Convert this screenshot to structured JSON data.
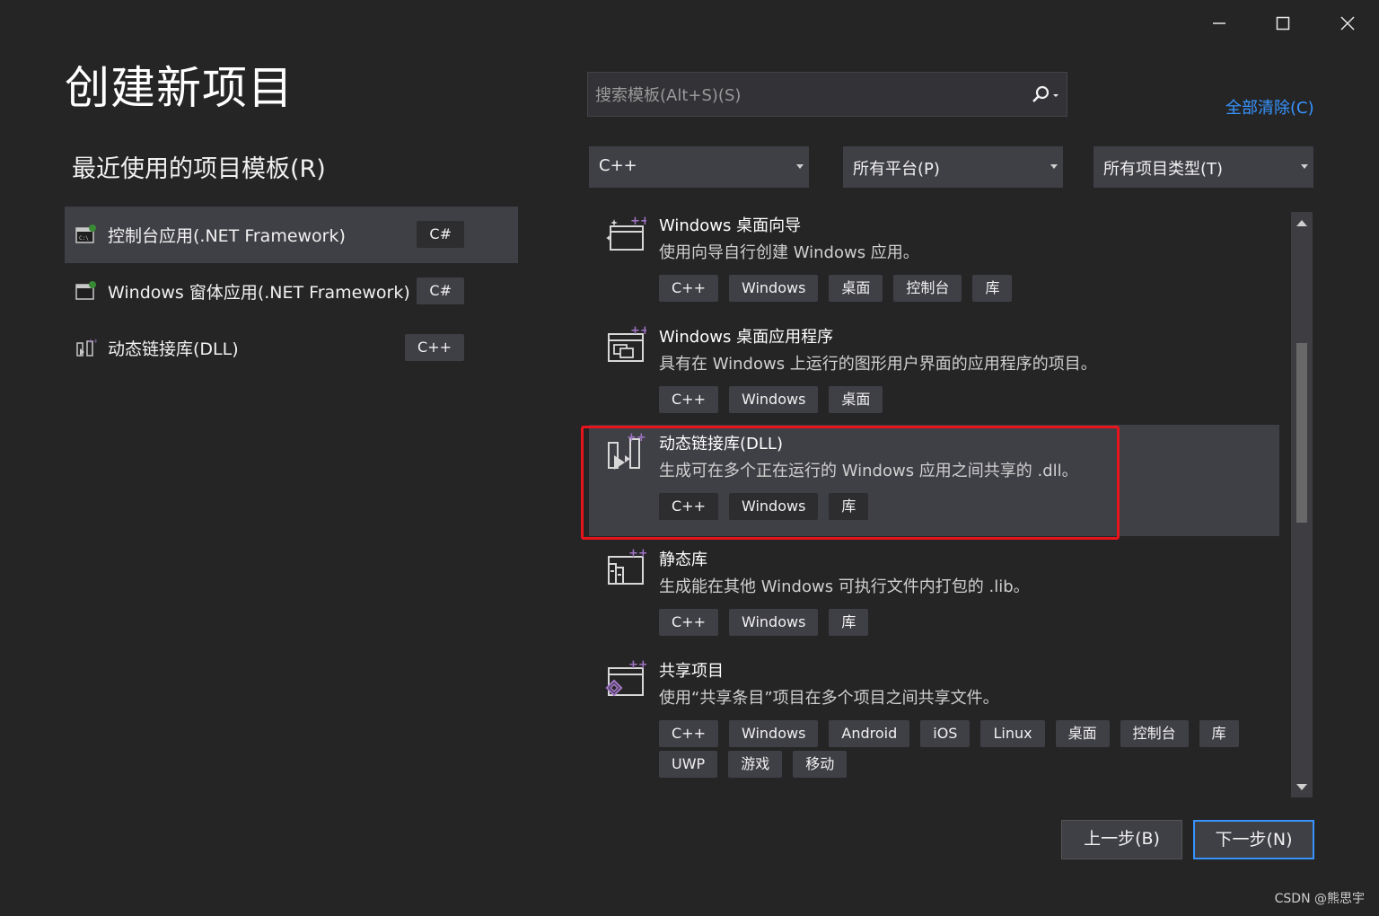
{
  "window": {
    "minimize_label": "minimize",
    "maximize_label": "maximize",
    "close_label": "close"
  },
  "page_title": "创建新项目",
  "recent": {
    "heading": "最近使用的项目模板(R)",
    "items": [
      {
        "label": "控制台应用(.NET Framework)",
        "lang": "C#"
      },
      {
        "label": "Windows 窗体应用(.NET Framework)",
        "lang": "C#"
      },
      {
        "label": "动态链接库(DLL)",
        "lang": "C++"
      }
    ]
  },
  "search": {
    "placeholder": "搜索模板(Alt+S)(S)",
    "value": ""
  },
  "clear_all": "全部清除(C)",
  "filters": {
    "language": "C++",
    "platform": "所有平台(P)",
    "project_type": "所有项目类型(T)"
  },
  "templates": [
    {
      "name": "Windows 桌面向导",
      "desc": "使用向导自行创建 Windows 应用。",
      "tags": [
        "C++",
        "Windows",
        "桌面",
        "控制台",
        "库"
      ],
      "icon": "desktop-wizard-icon"
    },
    {
      "name": "Windows 桌面应用程序",
      "desc": "具有在 Windows 上运行的图形用户界面的应用程序的项目。",
      "tags": [
        "C++",
        "Windows",
        "桌面"
      ],
      "icon": "desktop-app-icon"
    },
    {
      "name": "动态链接库(DLL)",
      "desc": "生成可在多个正在运行的 Windows 应用之间共享的 .dll。",
      "tags": [
        "C++",
        "Windows",
        "库"
      ],
      "icon": "dll-icon"
    },
    {
      "name": "静态库",
      "desc": "生成能在其他 Windows 可执行文件内打包的 .lib。",
      "tags": [
        "C++",
        "Windows",
        "库"
      ],
      "icon": "static-lib-icon"
    },
    {
      "name": "共享项目",
      "desc": "使用“共享条目”项目在多个项目之间共享文件。",
      "tags": [
        "C++",
        "Windows",
        "Android",
        "iOS",
        "Linux",
        "桌面",
        "控制台",
        "库",
        "UWP",
        "游戏",
        "移动"
      ],
      "icon": "shared-project-icon"
    }
  ],
  "buttons": {
    "back": "上一步(B)",
    "next": "下一步(N)"
  },
  "watermark": "CSDN @熊思宇",
  "colors": {
    "background": "#252526",
    "accent": "#3794ff",
    "highlight_box": "#e8141b"
  }
}
